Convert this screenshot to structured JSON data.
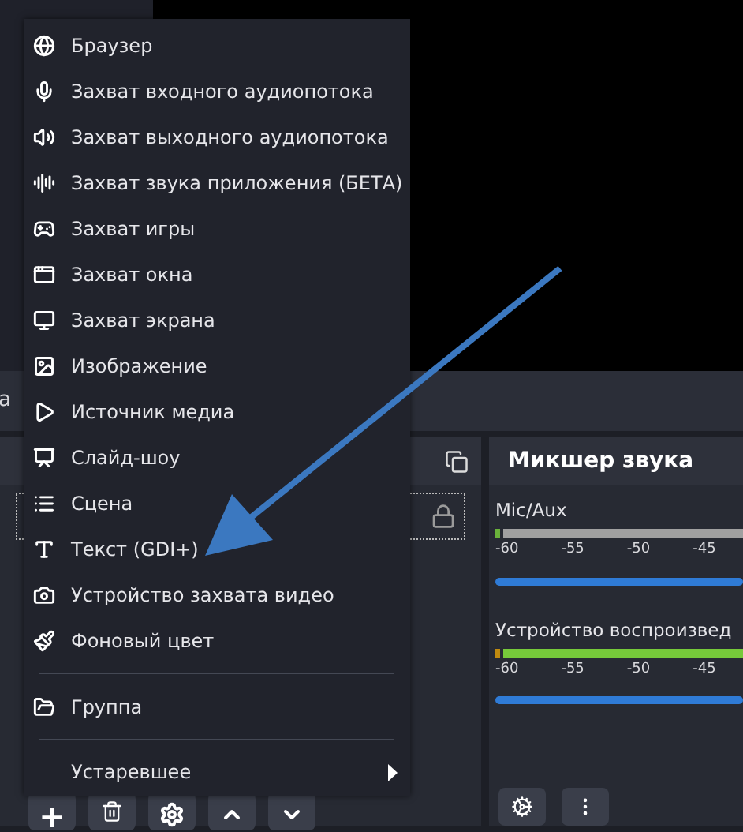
{
  "left_strip": {
    "text": "a"
  },
  "sources_panel": {
    "toolbar": [
      "+"
    ]
  },
  "mixer": {
    "title": "Микшер звука",
    "channels": [
      {
        "name": "Mic/Aux",
        "active": false,
        "level": 1,
        "ticks": [
          "-60",
          "-55",
          "-50",
          "-45"
        ]
      },
      {
        "name": "Устройство воспроизвед",
        "active": true,
        "level": 1,
        "ticks": [
          "-60",
          "-55",
          "-50",
          "-45"
        ]
      }
    ]
  },
  "menu": {
    "items": [
      {
        "kind": "item",
        "label": "Браузер"
      },
      {
        "kind": "item",
        "label": "Захват входного аудиопотока"
      },
      {
        "kind": "item",
        "label": "Захват выходного аудиопотока"
      },
      {
        "kind": "item",
        "label": "Захват звука приложения (БЕТА)"
      },
      {
        "kind": "item",
        "label": "Захват игры"
      },
      {
        "kind": "item",
        "label": "Захват окна"
      },
      {
        "kind": "item",
        "label": "Захват экрана"
      },
      {
        "kind": "item",
        "label": "Изображение"
      },
      {
        "kind": "item",
        "label": "Источник медиа"
      },
      {
        "kind": "item",
        "label": "Слайд-шоу"
      },
      {
        "kind": "item",
        "label": "Сцена"
      },
      {
        "kind": "item",
        "label": "Текст (GDI+)"
      },
      {
        "kind": "item",
        "label": "Устройство захвата видео"
      },
      {
        "kind": "item",
        "label": "Фоновый цвет"
      },
      {
        "kind": "separator"
      },
      {
        "kind": "item",
        "label": "Группа"
      },
      {
        "kind": "separator"
      },
      {
        "kind": "submenu",
        "label": "Устаревшее"
      }
    ]
  }
}
